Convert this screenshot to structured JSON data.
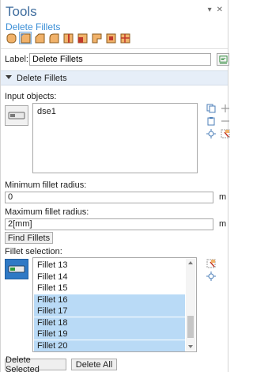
{
  "window": {
    "title": "Tools",
    "controls": [
      "▾",
      "✕"
    ]
  },
  "feature": {
    "name": "Delete Fillets"
  },
  "toolbar": {
    "tools": [
      {
        "icon": "rounded-square-icon",
        "active": false
      },
      {
        "icon": "fillet-square-icon",
        "active": true
      },
      {
        "icon": "chamfer-square-icon",
        "active": false
      },
      {
        "icon": "quarter-circle-icon",
        "active": false
      },
      {
        "icon": "split-square-icon",
        "active": false
      },
      {
        "icon": "split-square-alt-icon",
        "active": false
      },
      {
        "icon": "corner-flag-icon",
        "active": false
      },
      {
        "icon": "box-icon",
        "active": false
      },
      {
        "icon": "grid-box-icon",
        "active": false
      }
    ]
  },
  "label_row": {
    "label": "Label:",
    "value": "Delete Fillets"
  },
  "section": {
    "title": "Delete Fillets"
  },
  "input_objects": {
    "label": "Input objects:",
    "items": [
      "dse1"
    ]
  },
  "min_radius": {
    "label": "Minimum fillet radius:",
    "value": "0",
    "unit": "m"
  },
  "max_radius": {
    "label": "Maximum fillet radius:",
    "value": "2[mm]",
    "unit": "m"
  },
  "find_button": "Find Fillets",
  "fillet_selection": {
    "label": "Fillet selection:",
    "rows": [
      {
        "text": "Fillet 13",
        "selected": false
      },
      {
        "text": "Fillet 14",
        "selected": false
      },
      {
        "text": "Fillet 15",
        "selected": false
      },
      {
        "text": "Fillet 16",
        "selected": true
      },
      {
        "text": "Fillet 17",
        "selected": true
      },
      {
        "text": "Fillet 18",
        "selected": true
      },
      {
        "text": "Fillet 19",
        "selected": true
      },
      {
        "text": "Fillet 20",
        "selected": true
      }
    ]
  },
  "buttons": {
    "delete_selected": "Delete Selected",
    "delete_all": "Delete All"
  },
  "colors": {
    "title": "#3f6d9e",
    "link": "#3a8ed6",
    "selection": "#b9daf6",
    "active_button": "#2f79c5",
    "section_header": "#e6eef8"
  }
}
